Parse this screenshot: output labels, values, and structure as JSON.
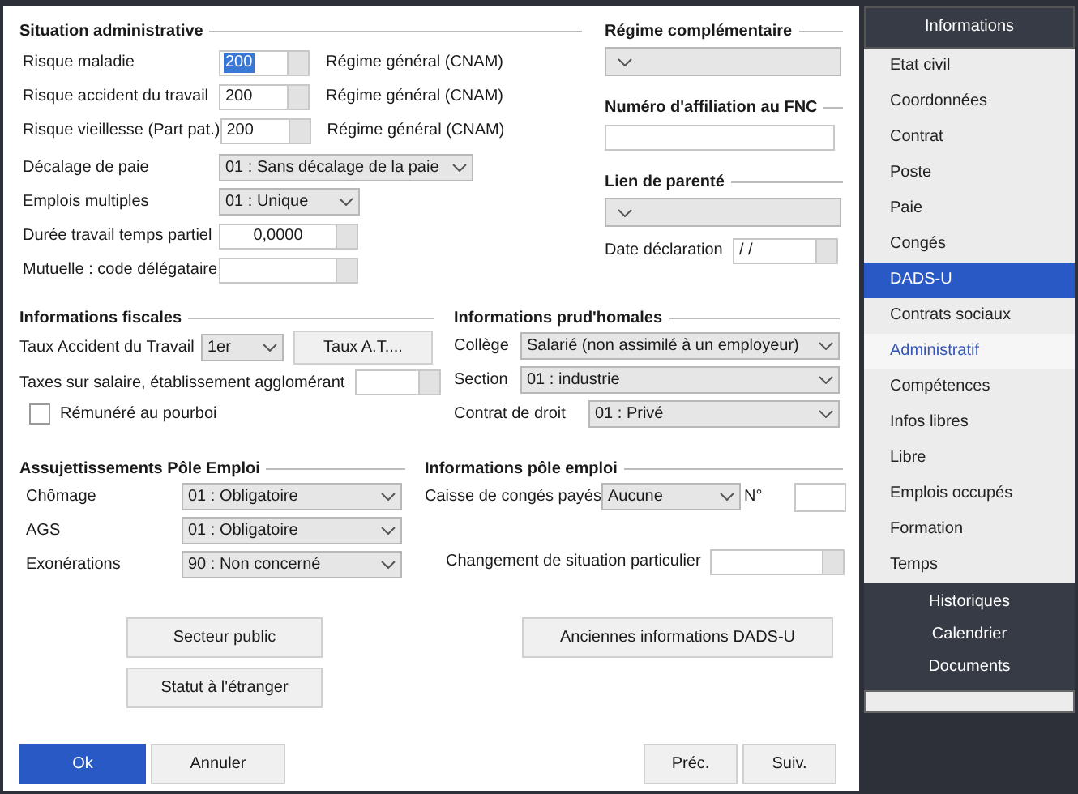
{
  "situation_administrative": {
    "title": "Situation administrative",
    "rows": [
      {
        "label": "Risque maladie",
        "kind": "lookup",
        "value": "200",
        "text_selected": true,
        "note": "Régime général (CNAM)"
      },
      {
        "label": "Risque accident du travail",
        "kind": "lookup",
        "value": "200",
        "text_selected": false,
        "note": "Régime général (CNAM)"
      },
      {
        "label": "Risque vieillesse (Part pat.)",
        "kind": "lookup",
        "value": "200",
        "text_selected": false,
        "note": "Régime général (CNAM)"
      },
      {
        "label": "Décalage de paie",
        "kind": "select",
        "value": "01 : Sans décalage de la paie"
      },
      {
        "label": "Emplois multiples",
        "kind": "select",
        "value": "01 : Unique"
      },
      {
        "label": "Durée travail temps partiel",
        "kind": "lookup",
        "value": "0,0000",
        "text_selected": false
      },
      {
        "label": "Mutuelle : code délégataire",
        "kind": "lookup"
      }
    ]
  },
  "regime_complementaire": {
    "title": "Régime complémentaire",
    "field": {
      "kind": "select"
    }
  },
  "numero_affiliation_fnc": {
    "title": "Numéro d'affiliation au FNC",
    "field": {
      "kind": "text"
    }
  },
  "lien_de_parente": {
    "title": "Lien de parenté",
    "field": {
      "kind": "select"
    },
    "date_declaration": {
      "label": "Date déclaration",
      "kind": "lookup",
      "value": " / /",
      "text_selected": false
    }
  },
  "informations_fiscales": {
    "title": "Informations fiscales",
    "rows": [
      {
        "label": "Taux Accident du Travail",
        "kind": "select",
        "value": "1er",
        "button": "Taux A.T...."
      },
      {
        "label": "Taxes sur salaire, établissement agglomérant",
        "kind": "lookup"
      }
    ],
    "checkbox": {
      "label": "Rémunéré au pourboi",
      "checked": false
    }
  },
  "informations_prudhomales": {
    "title": "Informations prud'homales",
    "rows": [
      {
        "label": "Collège",
        "kind": "select",
        "value": "Salarié (non assimilé à un employeur)"
      },
      {
        "label": "Section",
        "kind": "select",
        "value": "01 : industrie"
      },
      {
        "label": "Contrat de droit",
        "kind": "select",
        "value": "01 : Privé"
      }
    ]
  },
  "assujettissements_pole_emploi": {
    "title": "Assujettissements Pôle Emploi",
    "rows": [
      {
        "label": "Chômage",
        "kind": "select",
        "value": "01 : Obligatoire"
      },
      {
        "label": "AGS",
        "kind": "select",
        "value": "01 : Obligatoire"
      },
      {
        "label": "Exonérations",
        "kind": "select",
        "value": "90 : Non concerné"
      }
    ]
  },
  "informations_pole_emploi": {
    "title": "Informations pôle emploi",
    "rows": [
      {
        "label": "Caisse de congés payés",
        "kind": "select",
        "value": "Aucune",
        "suffix_label": "N°"
      },
      {
        "label": "Changement de situation particulier",
        "kind": "lookup"
      }
    ]
  },
  "action_buttons_left": [
    "Secteur public",
    "Statut à l'étranger"
  ],
  "action_buttons_right": [
    "Anciennes informations DADS-U"
  ],
  "footer_buttons": [
    {
      "label": "Ok",
      "kind": "primary"
    },
    {
      "label": "Annuler",
      "kind": "normal"
    },
    {
      "label": "Préc.",
      "kind": "normal"
    },
    {
      "label": "Suiv.",
      "kind": "normal"
    }
  ],
  "sidebar": {
    "header": "Informations",
    "items": [
      {
        "label": "Etat civil",
        "selected": false,
        "current_page": false
      },
      {
        "label": "Coordonnées",
        "selected": false,
        "current_page": false
      },
      {
        "label": "Contrat",
        "selected": false,
        "current_page": false
      },
      {
        "label": "Poste",
        "selected": false,
        "current_page": false
      },
      {
        "label": "Paie",
        "selected": false,
        "current_page": false
      },
      {
        "label": "Congés",
        "selected": false,
        "current_page": false
      },
      {
        "label": "DADS-U",
        "selected": true,
        "current_page": false
      },
      {
        "label": "Contrats sociaux",
        "selected": false,
        "current_page": false
      },
      {
        "label": "Administratif",
        "selected": false,
        "current_page": true
      },
      {
        "label": "Compétences",
        "selected": false,
        "current_page": false
      },
      {
        "label": "Infos libres",
        "selected": false,
        "current_page": false
      },
      {
        "label": "Libre",
        "selected": false,
        "current_page": false
      },
      {
        "label": "Emplois occupés",
        "selected": false,
        "current_page": false
      },
      {
        "label": "Formation",
        "selected": false,
        "current_page": false
      },
      {
        "label": "Temps",
        "selected": false,
        "current_page": false
      }
    ],
    "footer_items": [
      "Historiques",
      "Calendrier",
      "Documents"
    ]
  }
}
